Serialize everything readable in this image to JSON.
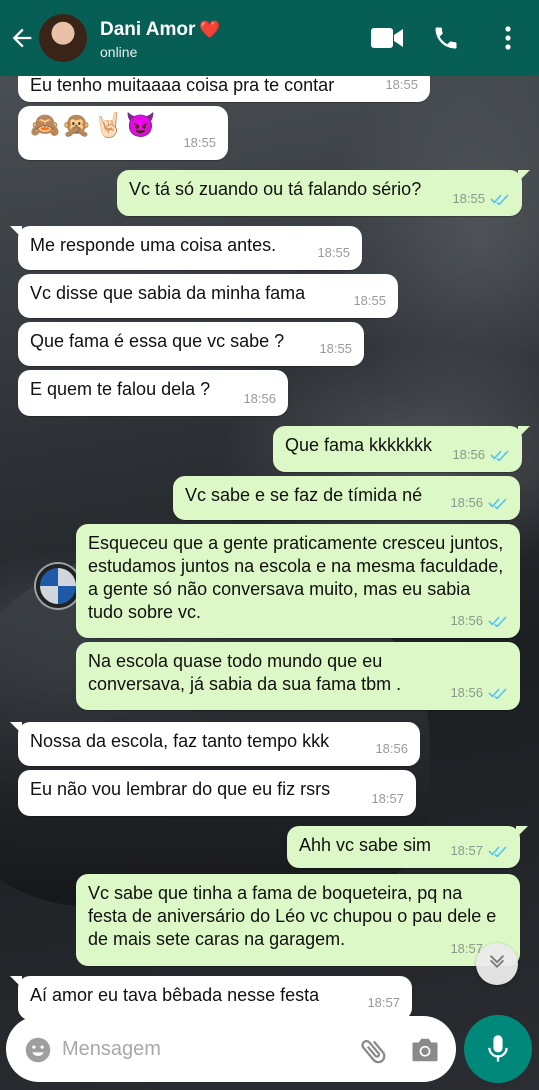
{
  "header": {
    "contact_name": "Dani Amor",
    "heart": "❤️",
    "status": "online"
  },
  "messages": [
    {
      "dir": "in",
      "text": "Eu tenho muitaaaa coisa pra te contar",
      "time": "18:55"
    },
    {
      "dir": "in",
      "text": "🙈🙊🤘🏻😈",
      "time": "18:55"
    },
    {
      "dir": "out",
      "text": "Vc tá só zuando ou tá falando sério?",
      "time": "18:55"
    },
    {
      "dir": "in",
      "text": "Me responde uma coisa antes.",
      "time": "18:55"
    },
    {
      "dir": "in",
      "text": "Vc disse que sabia da minha fama",
      "time": "18:55"
    },
    {
      "dir": "in",
      "text": "Que fama é essa que vc sabe ?",
      "time": "18:55"
    },
    {
      "dir": "in",
      "text": "E quem te falou dela ?",
      "time": "18:56"
    },
    {
      "dir": "out",
      "text": "Que fama kkkkkkk",
      "time": "18:56"
    },
    {
      "dir": "out",
      "text": "Vc sabe e se faz de tímida né",
      "time": "18:56"
    },
    {
      "dir": "out",
      "text": "Esqueceu que a gente praticamente cresceu juntos, estudamos juntos na escola e na mesma faculdade, a gente só não conversava muito, mas eu sabia tudo sobre vc.",
      "time": "18:56"
    },
    {
      "dir": "out",
      "text": "Na escola quase todo mundo que eu conversava, já sabia da sua fama tbm .",
      "time": "18:56"
    },
    {
      "dir": "in",
      "text": "Nossa da escola, faz tanto tempo kkk",
      "time": "18:56"
    },
    {
      "dir": "in",
      "text": "Eu não vou lembrar do que eu fiz rsrs",
      "time": "18:57"
    },
    {
      "dir": "out",
      "text": "Ahh vc sabe sim",
      "time": "18:57"
    },
    {
      "dir": "out",
      "text": "Vc sabe que tinha a fama de boqueteira, pq na festa de aniversário do Léo vc chupou o pau dele  e de mais sete caras na garagem.",
      "time": "18:57"
    },
    {
      "dir": "in",
      "text": "Aí amor eu tava bêbada nesse festa",
      "time": "18:57"
    }
  ],
  "input": {
    "placeholder": "Mensagem"
  },
  "colors": {
    "header": "#075e54",
    "outgoing_bubble": "#dcf8c6",
    "incoming_bubble": "#ffffff",
    "read_ticks": "#4fc3f7",
    "mic_button": "#00897b"
  },
  "icons": [
    "back-arrow-icon",
    "video-call-icon",
    "phone-icon",
    "more-vert-icon",
    "emoji-icon",
    "attach-icon",
    "camera-icon",
    "mic-icon",
    "chevron-down-icon",
    "read-ticks-icon"
  ]
}
